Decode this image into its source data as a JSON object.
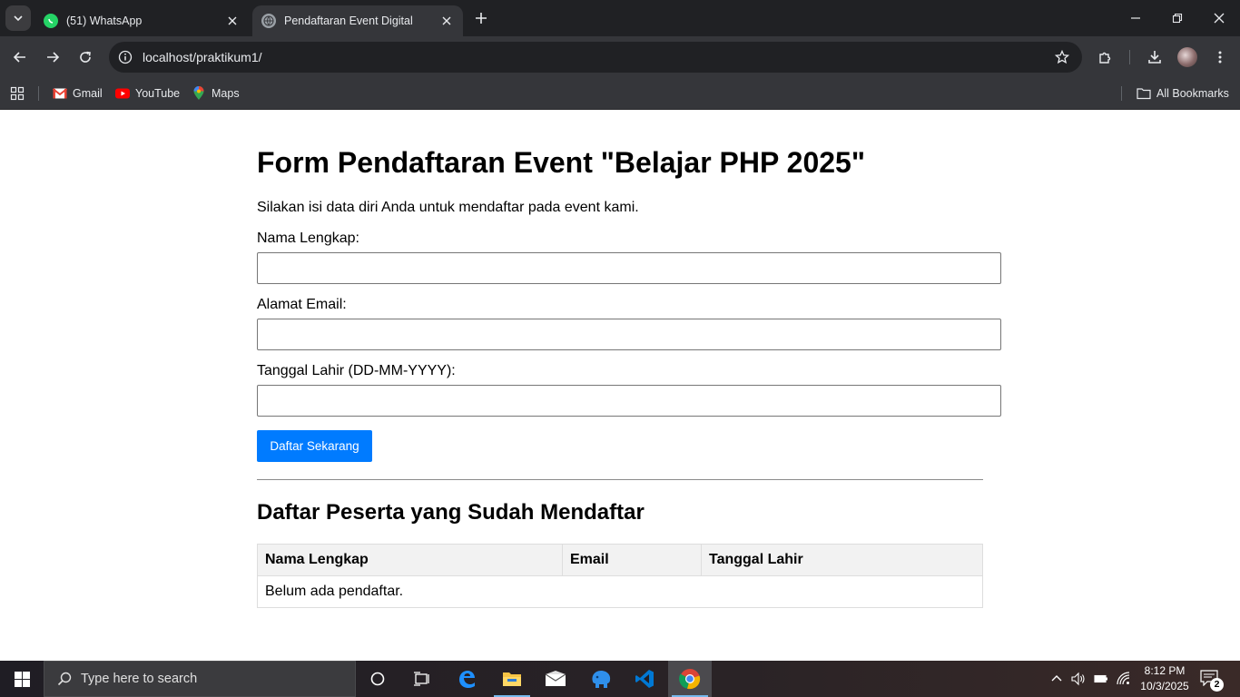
{
  "browser": {
    "tabs": [
      {
        "title": "(51) WhatsApp",
        "active": false,
        "icon": "whatsapp-icon"
      },
      {
        "title": "Pendaftaran Event Digital",
        "active": true,
        "icon": "globe-icon"
      }
    ],
    "url": "localhost/praktikum1/",
    "bookmarks": [
      {
        "label": "Gmail",
        "icon": "gmail-icon"
      },
      {
        "label": "YouTube",
        "icon": "youtube-icon"
      },
      {
        "label": "Maps",
        "icon": "maps-icon"
      }
    ],
    "all_bookmarks_label": "All Bookmarks"
  },
  "page": {
    "title": "Form Pendaftaran Event \"Belajar PHP 2025\"",
    "intro": "Silakan isi data diri Anda untuk mendaftar pada event kami.",
    "form": {
      "name_label": "Nama Lengkap:",
      "name_value": "",
      "email_label": "Alamat Email:",
      "email_value": "",
      "dob_label": "Tanggal Lahir (DD-MM-YYYY):",
      "dob_value": "",
      "submit_label": "Daftar Sekarang"
    },
    "list_title": "Daftar Peserta yang Sudah Mendaftar",
    "table": {
      "headers": [
        "Nama Lengkap",
        "Email",
        "Tanggal Lahir"
      ],
      "empty_message": "Belum ada pendaftar."
    }
  },
  "taskbar": {
    "search_placeholder": "Type here to search",
    "time": "8:12 PM",
    "date": "10/3/2025",
    "notification_count": "2"
  },
  "colors": {
    "accent_button": "#007bff",
    "chrome_dark": "#202124",
    "chrome_toolbar": "#35363a"
  }
}
